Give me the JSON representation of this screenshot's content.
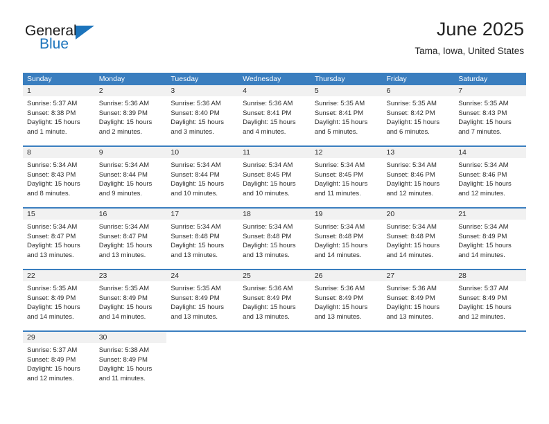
{
  "brand": {
    "name_part1": "General",
    "name_part2": "Blue",
    "accent_color": "#1c74bc",
    "logo_icon": "triangle-icon"
  },
  "header": {
    "title": "June 2025",
    "subtitle": "Tama, Iowa, United States"
  },
  "calendar": {
    "header_bg": "#3a7ebf",
    "daynum_bg": "#f1f1f1",
    "weekdays": [
      "Sunday",
      "Monday",
      "Tuesday",
      "Wednesday",
      "Thursday",
      "Friday",
      "Saturday"
    ],
    "weeks": [
      [
        {
          "day": "1",
          "sunrise": "Sunrise: 5:37 AM",
          "sunset": "Sunset: 8:38 PM",
          "daylight1": "Daylight: 15 hours",
          "daylight2": "and 1 minute."
        },
        {
          "day": "2",
          "sunrise": "Sunrise: 5:36 AM",
          "sunset": "Sunset: 8:39 PM",
          "daylight1": "Daylight: 15 hours",
          "daylight2": "and 2 minutes."
        },
        {
          "day": "3",
          "sunrise": "Sunrise: 5:36 AM",
          "sunset": "Sunset: 8:40 PM",
          "daylight1": "Daylight: 15 hours",
          "daylight2": "and 3 minutes."
        },
        {
          "day": "4",
          "sunrise": "Sunrise: 5:36 AM",
          "sunset": "Sunset: 8:41 PM",
          "daylight1": "Daylight: 15 hours",
          "daylight2": "and 4 minutes."
        },
        {
          "day": "5",
          "sunrise": "Sunrise: 5:35 AM",
          "sunset": "Sunset: 8:41 PM",
          "daylight1": "Daylight: 15 hours",
          "daylight2": "and 5 minutes."
        },
        {
          "day": "6",
          "sunrise": "Sunrise: 5:35 AM",
          "sunset": "Sunset: 8:42 PM",
          "daylight1": "Daylight: 15 hours",
          "daylight2": "and 6 minutes."
        },
        {
          "day": "7",
          "sunrise": "Sunrise: 5:35 AM",
          "sunset": "Sunset: 8:43 PM",
          "daylight1": "Daylight: 15 hours",
          "daylight2": "and 7 minutes."
        }
      ],
      [
        {
          "day": "8",
          "sunrise": "Sunrise: 5:34 AM",
          "sunset": "Sunset: 8:43 PM",
          "daylight1": "Daylight: 15 hours",
          "daylight2": "and 8 minutes."
        },
        {
          "day": "9",
          "sunrise": "Sunrise: 5:34 AM",
          "sunset": "Sunset: 8:44 PM",
          "daylight1": "Daylight: 15 hours",
          "daylight2": "and 9 minutes."
        },
        {
          "day": "10",
          "sunrise": "Sunrise: 5:34 AM",
          "sunset": "Sunset: 8:44 PM",
          "daylight1": "Daylight: 15 hours",
          "daylight2": "and 10 minutes."
        },
        {
          "day": "11",
          "sunrise": "Sunrise: 5:34 AM",
          "sunset": "Sunset: 8:45 PM",
          "daylight1": "Daylight: 15 hours",
          "daylight2": "and 10 minutes."
        },
        {
          "day": "12",
          "sunrise": "Sunrise: 5:34 AM",
          "sunset": "Sunset: 8:45 PM",
          "daylight1": "Daylight: 15 hours",
          "daylight2": "and 11 minutes."
        },
        {
          "day": "13",
          "sunrise": "Sunrise: 5:34 AM",
          "sunset": "Sunset: 8:46 PM",
          "daylight1": "Daylight: 15 hours",
          "daylight2": "and 12 minutes."
        },
        {
          "day": "14",
          "sunrise": "Sunrise: 5:34 AM",
          "sunset": "Sunset: 8:46 PM",
          "daylight1": "Daylight: 15 hours",
          "daylight2": "and 12 minutes."
        }
      ],
      [
        {
          "day": "15",
          "sunrise": "Sunrise: 5:34 AM",
          "sunset": "Sunset: 8:47 PM",
          "daylight1": "Daylight: 15 hours",
          "daylight2": "and 13 minutes."
        },
        {
          "day": "16",
          "sunrise": "Sunrise: 5:34 AM",
          "sunset": "Sunset: 8:47 PM",
          "daylight1": "Daylight: 15 hours",
          "daylight2": "and 13 minutes."
        },
        {
          "day": "17",
          "sunrise": "Sunrise: 5:34 AM",
          "sunset": "Sunset: 8:48 PM",
          "daylight1": "Daylight: 15 hours",
          "daylight2": "and 13 minutes."
        },
        {
          "day": "18",
          "sunrise": "Sunrise: 5:34 AM",
          "sunset": "Sunset: 8:48 PM",
          "daylight1": "Daylight: 15 hours",
          "daylight2": "and 13 minutes."
        },
        {
          "day": "19",
          "sunrise": "Sunrise: 5:34 AM",
          "sunset": "Sunset: 8:48 PM",
          "daylight1": "Daylight: 15 hours",
          "daylight2": "and 14 minutes."
        },
        {
          "day": "20",
          "sunrise": "Sunrise: 5:34 AM",
          "sunset": "Sunset: 8:48 PM",
          "daylight1": "Daylight: 15 hours",
          "daylight2": "and 14 minutes."
        },
        {
          "day": "21",
          "sunrise": "Sunrise: 5:34 AM",
          "sunset": "Sunset: 8:49 PM",
          "daylight1": "Daylight: 15 hours",
          "daylight2": "and 14 minutes."
        }
      ],
      [
        {
          "day": "22",
          "sunrise": "Sunrise: 5:35 AM",
          "sunset": "Sunset: 8:49 PM",
          "daylight1": "Daylight: 15 hours",
          "daylight2": "and 14 minutes."
        },
        {
          "day": "23",
          "sunrise": "Sunrise: 5:35 AM",
          "sunset": "Sunset: 8:49 PM",
          "daylight1": "Daylight: 15 hours",
          "daylight2": "and 14 minutes."
        },
        {
          "day": "24",
          "sunrise": "Sunrise: 5:35 AM",
          "sunset": "Sunset: 8:49 PM",
          "daylight1": "Daylight: 15 hours",
          "daylight2": "and 13 minutes."
        },
        {
          "day": "25",
          "sunrise": "Sunrise: 5:36 AM",
          "sunset": "Sunset: 8:49 PM",
          "daylight1": "Daylight: 15 hours",
          "daylight2": "and 13 minutes."
        },
        {
          "day": "26",
          "sunrise": "Sunrise: 5:36 AM",
          "sunset": "Sunset: 8:49 PM",
          "daylight1": "Daylight: 15 hours",
          "daylight2": "and 13 minutes."
        },
        {
          "day": "27",
          "sunrise": "Sunrise: 5:36 AM",
          "sunset": "Sunset: 8:49 PM",
          "daylight1": "Daylight: 15 hours",
          "daylight2": "and 13 minutes."
        },
        {
          "day": "28",
          "sunrise": "Sunrise: 5:37 AM",
          "sunset": "Sunset: 8:49 PM",
          "daylight1": "Daylight: 15 hours",
          "daylight2": "and 12 minutes."
        }
      ],
      [
        {
          "day": "29",
          "sunrise": "Sunrise: 5:37 AM",
          "sunset": "Sunset: 8:49 PM",
          "daylight1": "Daylight: 15 hours",
          "daylight2": "and 12 minutes."
        },
        {
          "day": "30",
          "sunrise": "Sunrise: 5:38 AM",
          "sunset": "Sunset: 8:49 PM",
          "daylight1": "Daylight: 15 hours",
          "daylight2": "and 11 minutes."
        },
        {
          "day": "",
          "sunrise": "",
          "sunset": "",
          "daylight1": "",
          "daylight2": ""
        },
        {
          "day": "",
          "sunrise": "",
          "sunset": "",
          "daylight1": "",
          "daylight2": ""
        },
        {
          "day": "",
          "sunrise": "",
          "sunset": "",
          "daylight1": "",
          "daylight2": ""
        },
        {
          "day": "",
          "sunrise": "",
          "sunset": "",
          "daylight1": "",
          "daylight2": ""
        },
        {
          "day": "",
          "sunrise": "",
          "sunset": "",
          "daylight1": "",
          "daylight2": ""
        }
      ]
    ]
  }
}
